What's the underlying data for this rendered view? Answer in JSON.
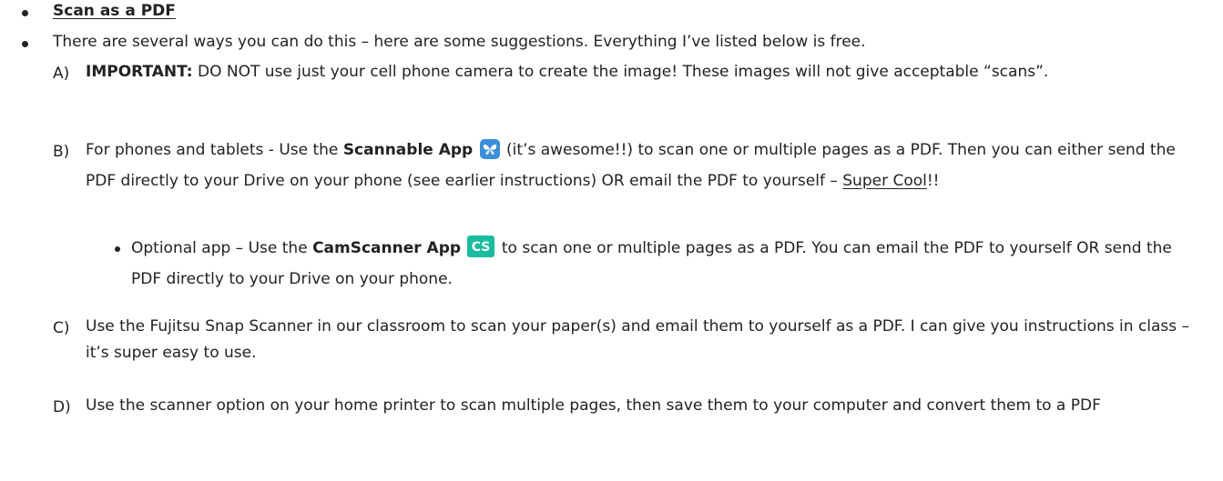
{
  "heading": "Scan as a PDF",
  "intro": "There are several ways you can do this – here are some suggestions. Everything I’ve listed below is free.",
  "items": [
    {
      "letter": "A)",
      "bold": "IMPORTANT:",
      "text": " DO NOT use just your cell phone camera to create the image! These images will not give acceptable “scans”."
    },
    {
      "letter": "B)",
      "pre": "For phones and tablets - Use the ",
      "bold": "Scannable App",
      "post": " (it’s awesome!!) to scan one or multiple pages as a PDF. Then you can either send the PDF directly to your Drive on your phone (see earlier instructions) OR email the PDF to yourself – ",
      "underlined": "Super Cool",
      "end": "!!",
      "icon": "butterfly-icon",
      "icon_color": "#3a8fd8"
    },
    {
      "letter": "C)",
      "text": "Use the Fujitsu Snap Scanner in our classroom to scan your paper(s) and email them to yourself as a PDF. I can give you instructions in class – it’s super easy to use."
    },
    {
      "letter": "D)",
      "text": "Use the scanner option on your home printer to scan multiple pages, then save them to your computer and convert them to a PDF"
    }
  ],
  "sub_item": {
    "pre": "Optional app – Use the ",
    "bold": "CamScanner App",
    "icon_text": "CS",
    "icon_color": "#19bc9c",
    "post": " to scan one or multiple pages as a PDF. You can email the PDF to yourself OR send the PDF directly to your Drive on your phone."
  }
}
